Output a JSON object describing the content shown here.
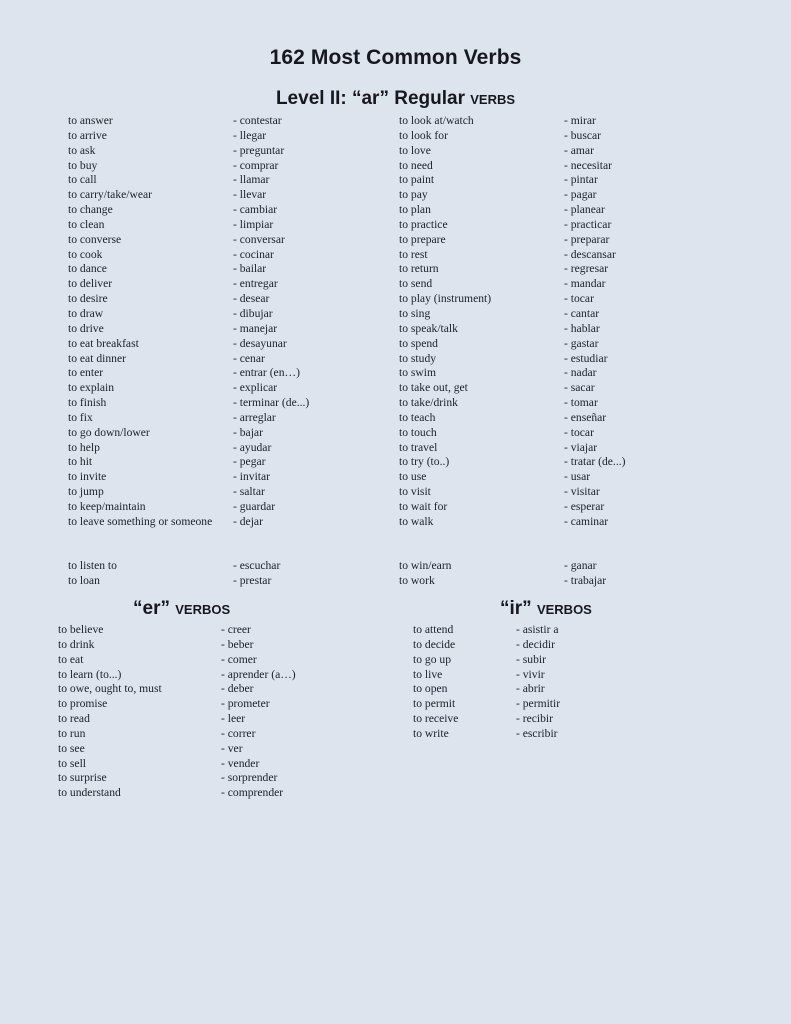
{
  "document": {
    "title": "162 Most Common Verbs",
    "level_heading": {
      "prefix": "Level II: “ar” Regular ",
      "smallcaps": "VERBS"
    }
  },
  "sections": {
    "ar": {
      "left_column": [
        {
          "en": "to answer",
          "es": "- contestar"
        },
        {
          "en": "to arrive",
          "es": "- llegar"
        },
        {
          "en": "to ask",
          "es": "- preguntar"
        },
        {
          "en": "to buy",
          "es": "- comprar"
        },
        {
          "en": "to call",
          "es": "- llamar"
        },
        {
          "en": "to carry/take/wear",
          "es": "- llevar"
        },
        {
          "en": "to change",
          "es": "- cambiar"
        },
        {
          "en": "to clean",
          "es": "- limpiar"
        },
        {
          "en": "to converse",
          "es": "- conversar"
        },
        {
          "en": "to cook",
          "es": "- cocinar"
        },
        {
          "en": "to dance",
          "es": "- bailar"
        },
        {
          "en": "to deliver",
          "es": "- entregar"
        },
        {
          "en": "to desire",
          "es": "- desear"
        },
        {
          "en": "to draw",
          "es": "- dibujar"
        },
        {
          "en": "to drive",
          "es": "- manejar"
        },
        {
          "en": "to eat breakfast",
          "es": "- desayunar"
        },
        {
          "en": "to eat dinner",
          "es": "- cenar"
        },
        {
          "en": "to enter",
          "es": "- entrar (en…)"
        },
        {
          "en": "to explain",
          "es": "- explicar"
        },
        {
          "en": "to finish",
          "es": "- terminar (de...)"
        },
        {
          "en": "to fix",
          "es": "- arreglar"
        },
        {
          "en": "to go down/lower",
          "es": "- bajar"
        },
        {
          "en": "to help",
          "es": "- ayudar"
        },
        {
          "en": "to hit",
          "es": "- pegar"
        },
        {
          "en": "to invite",
          "es": "- invitar"
        },
        {
          "en": "to jump",
          "es": "- saltar"
        },
        {
          "en": "to keep/maintain",
          "es": "- guardar"
        },
        {
          "en": "to leave something or someone",
          "es": "- dejar",
          "tall": true
        },
        {
          "en": "",
          "es": "",
          "blank": true
        },
        {
          "en": "to listen to",
          "es": "- escuchar"
        },
        {
          "en": "to loan",
          "es": "- prestar"
        }
      ],
      "right_column": [
        {
          "en": "to look at/watch",
          "es": "- mirar"
        },
        {
          "en": "to look for",
          "es": "- buscar"
        },
        {
          "en": "to love",
          "es": "- amar"
        },
        {
          "en": "to need",
          "es": "- necesitar"
        },
        {
          "en": "to paint",
          "es": "- pintar"
        },
        {
          "en": "to pay",
          "es": "- pagar"
        },
        {
          "en": "to plan",
          "es": "- planear"
        },
        {
          "en": "to practice",
          "es": "- practicar"
        },
        {
          "en": "to prepare",
          "es": "- preparar"
        },
        {
          "en": "to rest",
          "es": "- descansar"
        },
        {
          "en": "to return",
          "es": "- regresar"
        },
        {
          "en": "to send",
          "es": "- mandar"
        },
        {
          "en": "to play (instrument)",
          "es": "- tocar"
        },
        {
          "en": "to sing",
          "es": "- cantar"
        },
        {
          "en": "to speak/talk",
          "es": "- hablar"
        },
        {
          "en": "to spend",
          "es": "- gastar"
        },
        {
          "en": "to study",
          "es": "- estudiar"
        },
        {
          "en": "to swim",
          "es": "- nadar"
        },
        {
          "en": "to take out, get",
          "es": "- sacar"
        },
        {
          "en": "to take/drink",
          "es": "- tomar"
        },
        {
          "en": "to teach",
          "es": "- enseñar"
        },
        {
          "en": "to touch",
          "es": "- tocar"
        },
        {
          "en": "to travel",
          "es": "- viajar"
        },
        {
          "en": "to try (to..)",
          "es": "- tratar (de...)"
        },
        {
          "en": "to use",
          "es": "- usar"
        },
        {
          "en": "to visit",
          "es": "- visitar"
        },
        {
          "en": "to wait for",
          "es": "- esperar"
        },
        {
          "en": "to walk",
          "es": "- caminar"
        },
        {
          "en": "",
          "es": "",
          "blank": true
        },
        {
          "en": "",
          "es": "",
          "blank": true
        },
        {
          "en": "to win/earn",
          "es": "- ganar"
        },
        {
          "en": "to work",
          "es": "- trabajar"
        }
      ]
    },
    "er": {
      "heading": {
        "prefix": "“er” ",
        "smallcaps": "VERBOS"
      },
      "rows": [
        {
          "en": "to learn (to...)",
          "es": "- aprender (a…)"
        },
        {
          "en": "to believe",
          "es": "- creer"
        },
        {
          "en": "to drink",
          "es": "- beber"
        },
        {
          "en": "to eat",
          "es": "- comer"
        },
        {
          "en": "to owe, ought to, must",
          "es": "- deber"
        },
        {
          "en": "to promise",
          "es": "- prometer"
        },
        {
          "en": "to read",
          "es": "- leer"
        },
        {
          "en": "to run",
          "es": "- correr"
        },
        {
          "en": "to see",
          "es": "- ver"
        },
        {
          "en": "to sell",
          "es": "- vender"
        },
        {
          "en": "to surprise",
          "es": "- sorprender"
        },
        {
          "en": "to understand",
          "es": "- comprender"
        }
      ],
      "rows_ordered": [
        {
          "en": "to believe",
          "es": "- creer"
        },
        {
          "en": "to drink",
          "es": "- beber"
        },
        {
          "en": "to eat",
          "es": "- comer"
        },
        {
          "en": "to learn (to...)",
          "es": "- aprender (a…)"
        },
        {
          "en": "to owe, ought to, must",
          "es": "- deber"
        },
        {
          "en": "to promise",
          "es": "- prometer"
        },
        {
          "en": "to read",
          "es": "- leer"
        },
        {
          "en": "to run",
          "es": "- correr"
        },
        {
          "en": "to see",
          "es": "- ver"
        },
        {
          "en": "to sell",
          "es": "- vender"
        },
        {
          "en": "to surprise",
          "es": "- sorprender"
        },
        {
          "en": "to understand",
          "es": "- comprender"
        }
      ]
    },
    "ir": {
      "heading": {
        "prefix": "“ir” ",
        "smallcaps": "VERBOS"
      },
      "rows": [
        {
          "en": "to attend",
          "es": "- asistir a"
        },
        {
          "en": "to decide",
          "es": "- decidir"
        },
        {
          "en": "to go up",
          "es": "- subir"
        },
        {
          "en": "to live",
          "es": "- vivir"
        },
        {
          "en": "to open",
          "es": "- abrir"
        },
        {
          "en": "to permit",
          "es": "- permitir"
        },
        {
          "en": "to receive",
          "es": "- recibir"
        },
        {
          "en": "to write",
          "es": "- escribir"
        }
      ]
    }
  },
  "colors": {
    "page_background": "#dde4ee",
    "text": "#1c1f26",
    "heading": "#15181e"
  }
}
